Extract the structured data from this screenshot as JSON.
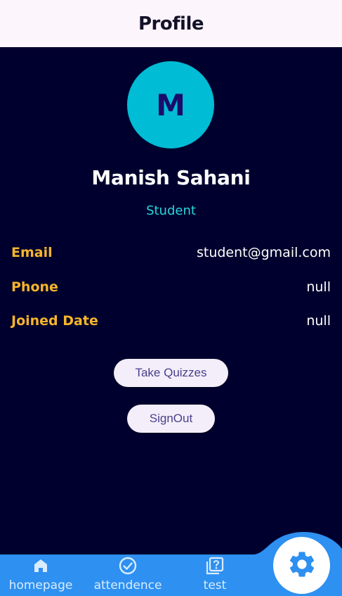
{
  "app_bar": {
    "title": "Profile"
  },
  "profile": {
    "avatar_initial": "M",
    "name": "Manish Sahani",
    "role": "Student",
    "fields": [
      {
        "label": "Email",
        "value": "student@gmail.com"
      },
      {
        "label": "Phone",
        "value": "null"
      },
      {
        "label": "Joined Date",
        "value": "null"
      }
    ]
  },
  "actions": {
    "take_quizzes_label": "Take Quizzes",
    "signout_label": "SignOut"
  },
  "bottom_nav": {
    "items": [
      {
        "label": "homepage",
        "icon": "home-icon"
      },
      {
        "label": "attendence",
        "icon": "check-circle-icon"
      },
      {
        "label": "test",
        "icon": "quiz-icon"
      }
    ],
    "fab_icon": "gear-icon"
  },
  "colors": {
    "background": "#00002e",
    "app_bar": "#fdf5fc",
    "avatar": "#00bcd4",
    "label": "#f7b52a",
    "role": "#29d5de",
    "nav": "#2e90f0"
  }
}
